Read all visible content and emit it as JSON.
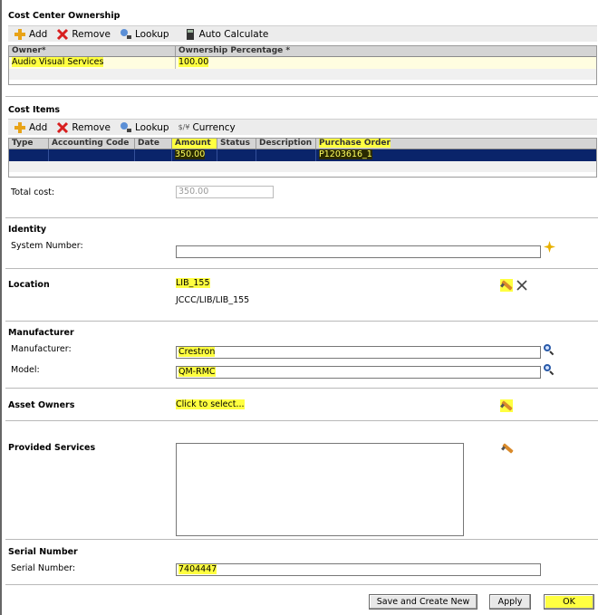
{
  "cost_center_ownership": {
    "title": "Cost Center Ownership",
    "toolbar": {
      "add": "Add",
      "remove": "Remove",
      "lookup": "Lookup",
      "auto_calculate": "Auto Calculate"
    },
    "columns": [
      "Owner*",
      "Ownership Percentage *"
    ],
    "rows": [
      {
        "owner": "Audio Visual Services",
        "percentage": "100.00"
      }
    ]
  },
  "cost_items": {
    "title": "Cost Items",
    "toolbar": {
      "add": "Add",
      "remove": "Remove",
      "lookup": "Lookup",
      "currency": "Currency",
      "currency_symbol": "$/¥"
    },
    "columns": [
      "Type",
      "Accounting Code",
      "Date",
      "Amount",
      "Status",
      "Description",
      "Purchase Order"
    ],
    "rows": [
      {
        "type": "",
        "accounting_code": "",
        "date": "",
        "amount": "350.00",
        "status": "",
        "description": "",
        "purchase_order": "P1203616_1"
      }
    ],
    "total_cost_label": "Total cost:",
    "total_cost_value": "350.00"
  },
  "identity": {
    "title": "Identity",
    "system_number_label": "System Number:",
    "system_number_value": ""
  },
  "location": {
    "title": "Location",
    "value": "LIB_155",
    "path": "JCCC/LIB/LIB_155"
  },
  "manufacturer": {
    "title": "Manufacturer",
    "manufacturer_label": "Manufacturer:",
    "manufacturer_value": "Crestron",
    "model_label": "Model:",
    "model_value": "QM-RMC"
  },
  "asset_owners": {
    "title": "Asset Owners",
    "link": "Click to select..."
  },
  "provided_services": {
    "title": "Provided Services",
    "value": ""
  },
  "serial_number": {
    "title": "Serial Number",
    "label": "Serial Number:",
    "value": "7404447"
  },
  "footer": {
    "save_new": "Save and Create New",
    "apply": "Apply",
    "ok": "OK"
  },
  "colors": {
    "highlight": "#ffff40",
    "selected_row": "#0a246a",
    "grid_header": "#d4d4d4"
  }
}
